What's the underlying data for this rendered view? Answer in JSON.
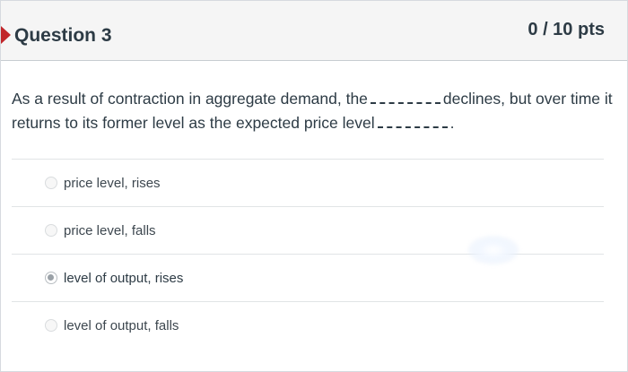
{
  "question": {
    "title": "Question 3",
    "points": "0 / 10 pts",
    "text_part1": "As a result of contraction in aggregate demand, the",
    "text_part2": "declines, but over time it returns to its former level as the expected price level",
    "text_part3": "."
  },
  "answers": [
    {
      "label": "price level, rises",
      "selected": false
    },
    {
      "label": "price level, falls",
      "selected": false
    },
    {
      "label": "level of output, rises",
      "selected": true
    },
    {
      "label": "level of output, falls",
      "selected": false
    }
  ],
  "colors": {
    "flag": "#c1262a",
    "header_bg": "#f5f5f5",
    "text": "#2d3b45"
  },
  "icons": {
    "flag": "incorrect-flag-icon",
    "radio": "radio-button-icon"
  }
}
